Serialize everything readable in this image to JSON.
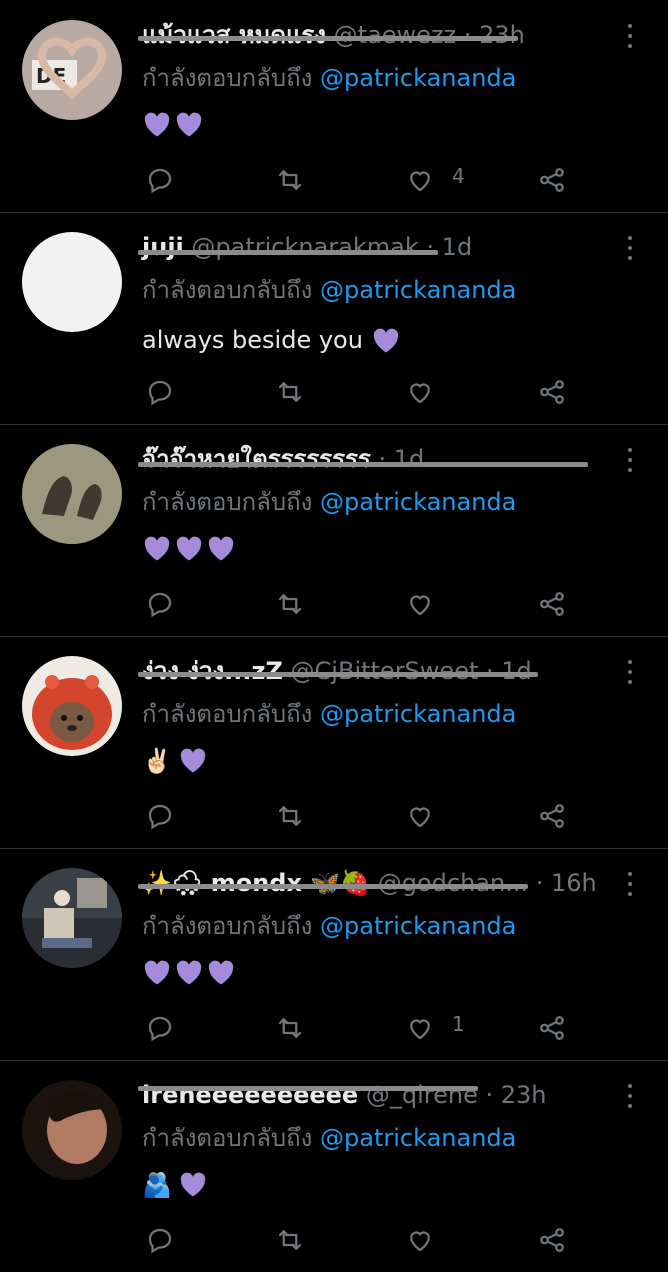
{
  "reply_prefix": "กำลังตอบกลับถึง",
  "mention": "@patrickananda",
  "colors": {
    "background": "#000000",
    "text": "#e7e9ea",
    "muted": "#71767b",
    "link": "#1d9bf0",
    "heart": "#a78bdb",
    "separator": "#2f3336"
  },
  "tweets": [
    {
      "name": "แม้วแวส หมดแรง",
      "name_emoji": "purple-heart",
      "handle": "@taewezz",
      "time": "23h",
      "body": "",
      "hearts": 2,
      "emoji_prefix": "",
      "reply_count": "",
      "retweet_count": "",
      "like_count": "4",
      "share_count": ""
    },
    {
      "name": "juji",
      "name_emoji": "",
      "handle": "@patricknarakmak",
      "time": "1d",
      "body": "always beside you",
      "hearts": 1,
      "emoji_prefix": "",
      "reply_count": "",
      "retweet_count": "",
      "like_count": "",
      "share_count": ""
    },
    {
      "name": "จ๊าจ๊าหายใตรรรรรรรร",
      "name_emoji": "",
      "handle": "",
      "time": "1d",
      "body": "",
      "hearts": 3,
      "emoji_prefix": "",
      "reply_count": "",
      "retweet_count": "",
      "like_count": "",
      "share_count": ""
    },
    {
      "name": "ง่วง ง่วง...zZ",
      "name_emoji": "",
      "handle": "@CjBitterSweet",
      "time": "1d",
      "body": "",
      "hearts": 1,
      "emoji_prefix": "✌🏻",
      "reply_count": "",
      "retweet_count": "",
      "like_count": "",
      "share_count": ""
    },
    {
      "name": "✨🌨 mondx 🦋🍓",
      "name_emoji": "",
      "handle": "@godchan...",
      "time": "16h",
      "body": "",
      "hearts": 3,
      "emoji_prefix": "",
      "reply_count": "",
      "retweet_count": "",
      "like_count": "1",
      "share_count": ""
    },
    {
      "name": "ireneeeeeeeeee",
      "name_emoji": "",
      "handle": "@_qirene",
      "time": "23h",
      "body": "",
      "hearts": 1,
      "emoji_prefix": "🫂",
      "reply_count": "",
      "retweet_count": "",
      "like_count": "",
      "share_count": ""
    }
  ]
}
